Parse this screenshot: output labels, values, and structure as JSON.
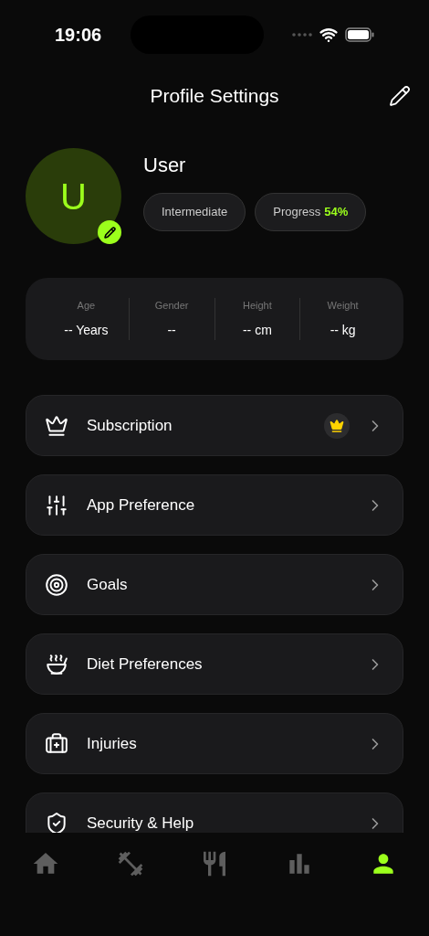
{
  "status_bar": {
    "time": "19:06"
  },
  "header": {
    "title": "Profile Settings"
  },
  "profile": {
    "initial": "U",
    "name": "User",
    "level": "Intermediate",
    "progress_label": "Progress",
    "progress_value": "54%"
  },
  "stats": [
    {
      "label": "Age",
      "value": "-- Years"
    },
    {
      "label": "Gender",
      "value": "--"
    },
    {
      "label": "Height",
      "value": "-- cm"
    },
    {
      "label": "Weight",
      "value": "-- kg"
    }
  ],
  "menu": [
    {
      "kind": "subscription",
      "label": "Subscription",
      "premium_badge": true
    },
    {
      "kind": "preferences",
      "label": "App Preference",
      "premium_badge": false
    },
    {
      "kind": "goals",
      "label": "Goals",
      "premium_badge": false
    },
    {
      "kind": "diet",
      "label": "Diet Preferences",
      "premium_badge": false
    },
    {
      "kind": "injuries",
      "label": "Injuries",
      "premium_badge": false
    },
    {
      "kind": "security",
      "label": "Security & Help",
      "premium_badge": false
    }
  ],
  "tab_bar": [
    {
      "kind": "home",
      "selected": false
    },
    {
      "kind": "workouts",
      "selected": false
    },
    {
      "kind": "meals",
      "selected": false
    },
    {
      "kind": "stats",
      "selected": false
    },
    {
      "kind": "profile",
      "selected": true
    }
  ]
}
